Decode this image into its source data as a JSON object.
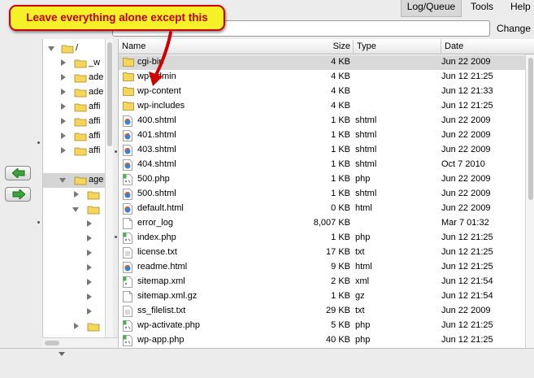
{
  "menu": {
    "log_queue": "Log/Queue",
    "tools": "Tools",
    "help": "Help"
  },
  "path": {
    "value": "/",
    "change_label": "Change"
  },
  "callout": {
    "text": "Leave everything alone except this"
  },
  "tree": {
    "root_label": "/",
    "items": [
      {
        "label": "_w",
        "expanded": false
      },
      {
        "label": "ade",
        "expanded": false
      },
      {
        "label": "ade",
        "expanded": false
      },
      {
        "label": "affi",
        "expanded": false
      },
      {
        "label": "affi",
        "expanded": false
      },
      {
        "label": "affi",
        "expanded": false
      },
      {
        "label": "affi",
        "expanded": false
      },
      {
        "label": "age",
        "expanded": true,
        "selected": true
      }
    ]
  },
  "columns": {
    "name": "Name",
    "size": "Size",
    "type": "Type",
    "date": "Date"
  },
  "files": [
    {
      "name": "cgi-bin",
      "size": "4 KB",
      "type": "",
      "date": "Jun 22 2009",
      "icon": "folder-icon",
      "selected": true
    },
    {
      "name": "wp-admin",
      "size": "4 KB",
      "type": "",
      "date": "Jun 12 21:25",
      "icon": "folder-icon"
    },
    {
      "name": "wp-content",
      "size": "4 KB",
      "type": "",
      "date": "Jun 12 21:33",
      "icon": "folder-icon"
    },
    {
      "name": "wp-includes",
      "size": "4 KB",
      "type": "",
      "date": "Jun 12 21:25",
      "icon": "folder-icon"
    },
    {
      "name": "400.shtml",
      "size": "1 KB",
      "type": "shtml",
      "date": "Jun 22 2009",
      "icon": "html-file-icon"
    },
    {
      "name": "401.shtml",
      "size": "1 KB",
      "type": "shtml",
      "date": "Jun 22 2009",
      "icon": "html-file-icon"
    },
    {
      "name": "403.shtml",
      "size": "1 KB",
      "type": "shtml",
      "date": "Jun 22 2009",
      "icon": "html-file-icon"
    },
    {
      "name": "404.shtml",
      "size": "1 KB",
      "type": "shtml",
      "date": "Oct 7 2010",
      "icon": "html-file-icon"
    },
    {
      "name": "500.php",
      "size": "1 KB",
      "type": "php",
      "date": "Jun 22 2009",
      "icon": "php-file-icon"
    },
    {
      "name": "500.shtml",
      "size": "1 KB",
      "type": "shtml",
      "date": "Jun 22 2009",
      "icon": "html-file-icon"
    },
    {
      "name": "default.html",
      "size": "0 KB",
      "type": "html",
      "date": "Jun 22 2009",
      "icon": "html-file-icon"
    },
    {
      "name": "error_log",
      "size": "8,007 KB",
      "type": "",
      "date": "Mar 7 01:32",
      "icon": "generic-file-icon"
    },
    {
      "name": "index.php",
      "size": "1 KB",
      "type": "php",
      "date": "Jun 12 21:25",
      "icon": "php-file-icon"
    },
    {
      "name": "license.txt",
      "size": "17 KB",
      "type": "txt",
      "date": "Jun 12 21:25",
      "icon": "text-file-icon"
    },
    {
      "name": "readme.html",
      "size": "9 KB",
      "type": "html",
      "date": "Jun 12 21:25",
      "icon": "html-file-icon"
    },
    {
      "name": "sitemap.xml",
      "size": "2 KB",
      "type": "xml",
      "date": "Jun 12 21:54",
      "icon": "xml-file-icon"
    },
    {
      "name": "sitemap.xml.gz",
      "size": "1 KB",
      "type": "gz",
      "date": "Jun 12 21:54",
      "icon": "generic-file-icon"
    },
    {
      "name": "ss_filelist.txt",
      "size": "29 KB",
      "type": "txt",
      "date": "Jun 22 2009",
      "icon": "text-file-icon"
    },
    {
      "name": "wp-activate.php",
      "size": "5 KB",
      "type": "php",
      "date": "Jun 12 21:25",
      "icon": "php-file-icon"
    },
    {
      "name": "wp-app.php",
      "size": "40 KB",
      "type": "php",
      "date": "Jun 12 21:25",
      "icon": "php-file-icon"
    }
  ],
  "colors": {
    "callout_bg": "#f4f129",
    "callout_border": "#d00000",
    "arrow": "#d00000",
    "selection": "#d9d9d9",
    "folder": "#f6d55b"
  }
}
